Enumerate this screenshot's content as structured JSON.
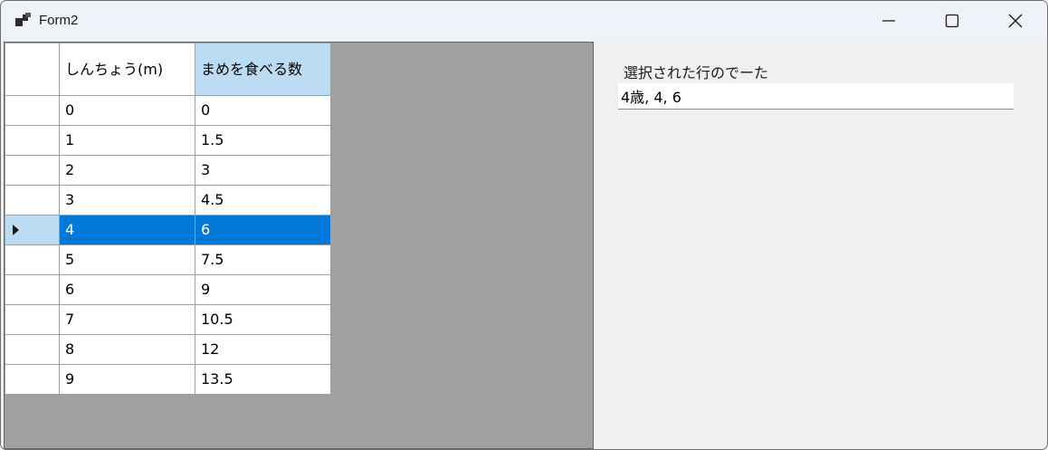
{
  "window": {
    "title": "Form2",
    "controls": {
      "minimize": "minimize",
      "maximize": "maximize",
      "close": "close"
    }
  },
  "grid": {
    "columns": [
      "しんちょう(m)",
      "まめを食べる数"
    ],
    "selected_row": 4,
    "rows": [
      [
        "0",
        "0"
      ],
      [
        "1",
        "1.5"
      ],
      [
        "2",
        "3"
      ],
      [
        "3",
        "4.5"
      ],
      [
        "4",
        "6"
      ],
      [
        "5",
        "7.5"
      ],
      [
        "6",
        "9"
      ],
      [
        "7",
        "10.5"
      ],
      [
        "8",
        "12"
      ],
      [
        "9",
        "13.5"
      ]
    ]
  },
  "selection_panel": {
    "label": "選択された行のでーた",
    "value": "4歳, 4, 6"
  },
  "colors": {
    "selection": "#0078d7",
    "header_selected": "#bcdcf4",
    "grid_background": "#a0a0a0",
    "titlebar": "#eff2f9"
  }
}
